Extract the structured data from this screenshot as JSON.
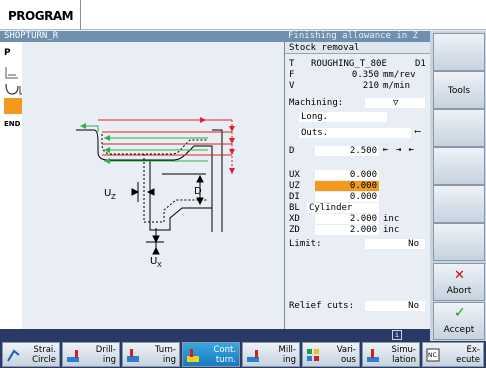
{
  "title": "PROGRAM",
  "header": {
    "left": "SHOPTURN_R",
    "right": "Finishing allowance in Z"
  },
  "left_strip": {
    "end_label": "END",
    "p_label": "P"
  },
  "panel": {
    "section_title": "Stock removal",
    "rows": {
      "t_label": "T",
      "t_value": "ROUGHING_T_80E",
      "t_d": "D1",
      "f_label": "F",
      "f_value": "0.350",
      "f_unit": "mm/rev",
      "v_label": "V",
      "v_value": "210",
      "v_unit": "m/min",
      "machining_label": "Machining:",
      "machining_value": "▽",
      "long": "Long.",
      "outs": "Outs.",
      "d_label": "D",
      "d_value": "2.500",
      "ux_label": "UX",
      "ux_value": "0.000",
      "uz_label": "UZ",
      "uz_value": "0.000",
      "di_label": "DI",
      "di_value": "0.000",
      "bl_label": "BL",
      "bl_value": "Cylinder",
      "xd_label": "XD",
      "xd_value": "2.000",
      "xd_unit": "inc",
      "zd_label": "ZD",
      "zd_value": "2.000",
      "zd_unit": "inc",
      "limit_label": "Limit:",
      "limit_value": "No",
      "relief_label": "Relief cuts:",
      "relief_value": "No"
    }
  },
  "drawing_labels": {
    "d": "D",
    "uz": "U",
    "uz_sub": "Z",
    "ux": "U",
    "ux_sub": "X"
  },
  "right_softkeys": [
    {
      "label": ""
    },
    {
      "label": "Tools"
    },
    {
      "label": ""
    },
    {
      "label": ""
    },
    {
      "label": ""
    },
    {
      "label": ""
    },
    {
      "label": "Abort"
    },
    {
      "label": "Accept"
    }
  ],
  "bottom_softkeys": [
    {
      "label": "Strai.\nCircle",
      "icon": "straight-circle-icon"
    },
    {
      "label": "Drill-\ning",
      "icon": "drill-icon"
    },
    {
      "label": "Turn-\ning",
      "icon": "turning-icon"
    },
    {
      "label": "Cont.\nturn.",
      "icon": "contour-turning-icon",
      "active": true
    },
    {
      "label": "Mill-\ning",
      "icon": "mill-icon"
    },
    {
      "label": "Vari-\nous",
      "icon": "various-icon"
    },
    {
      "label": "Simu-\nlation",
      "icon": "simulation-icon"
    },
    {
      "label": "Ex-\necute",
      "icon": "execute-icon"
    }
  ],
  "colors": {
    "header_bg": "#6f8faf",
    "highlight": "#f39a1e",
    "dark_bar": "#2a3a66",
    "active_key": "#1a78c0",
    "toolpath_red": "#e0202a",
    "toolpath_green": "#30b040"
  }
}
